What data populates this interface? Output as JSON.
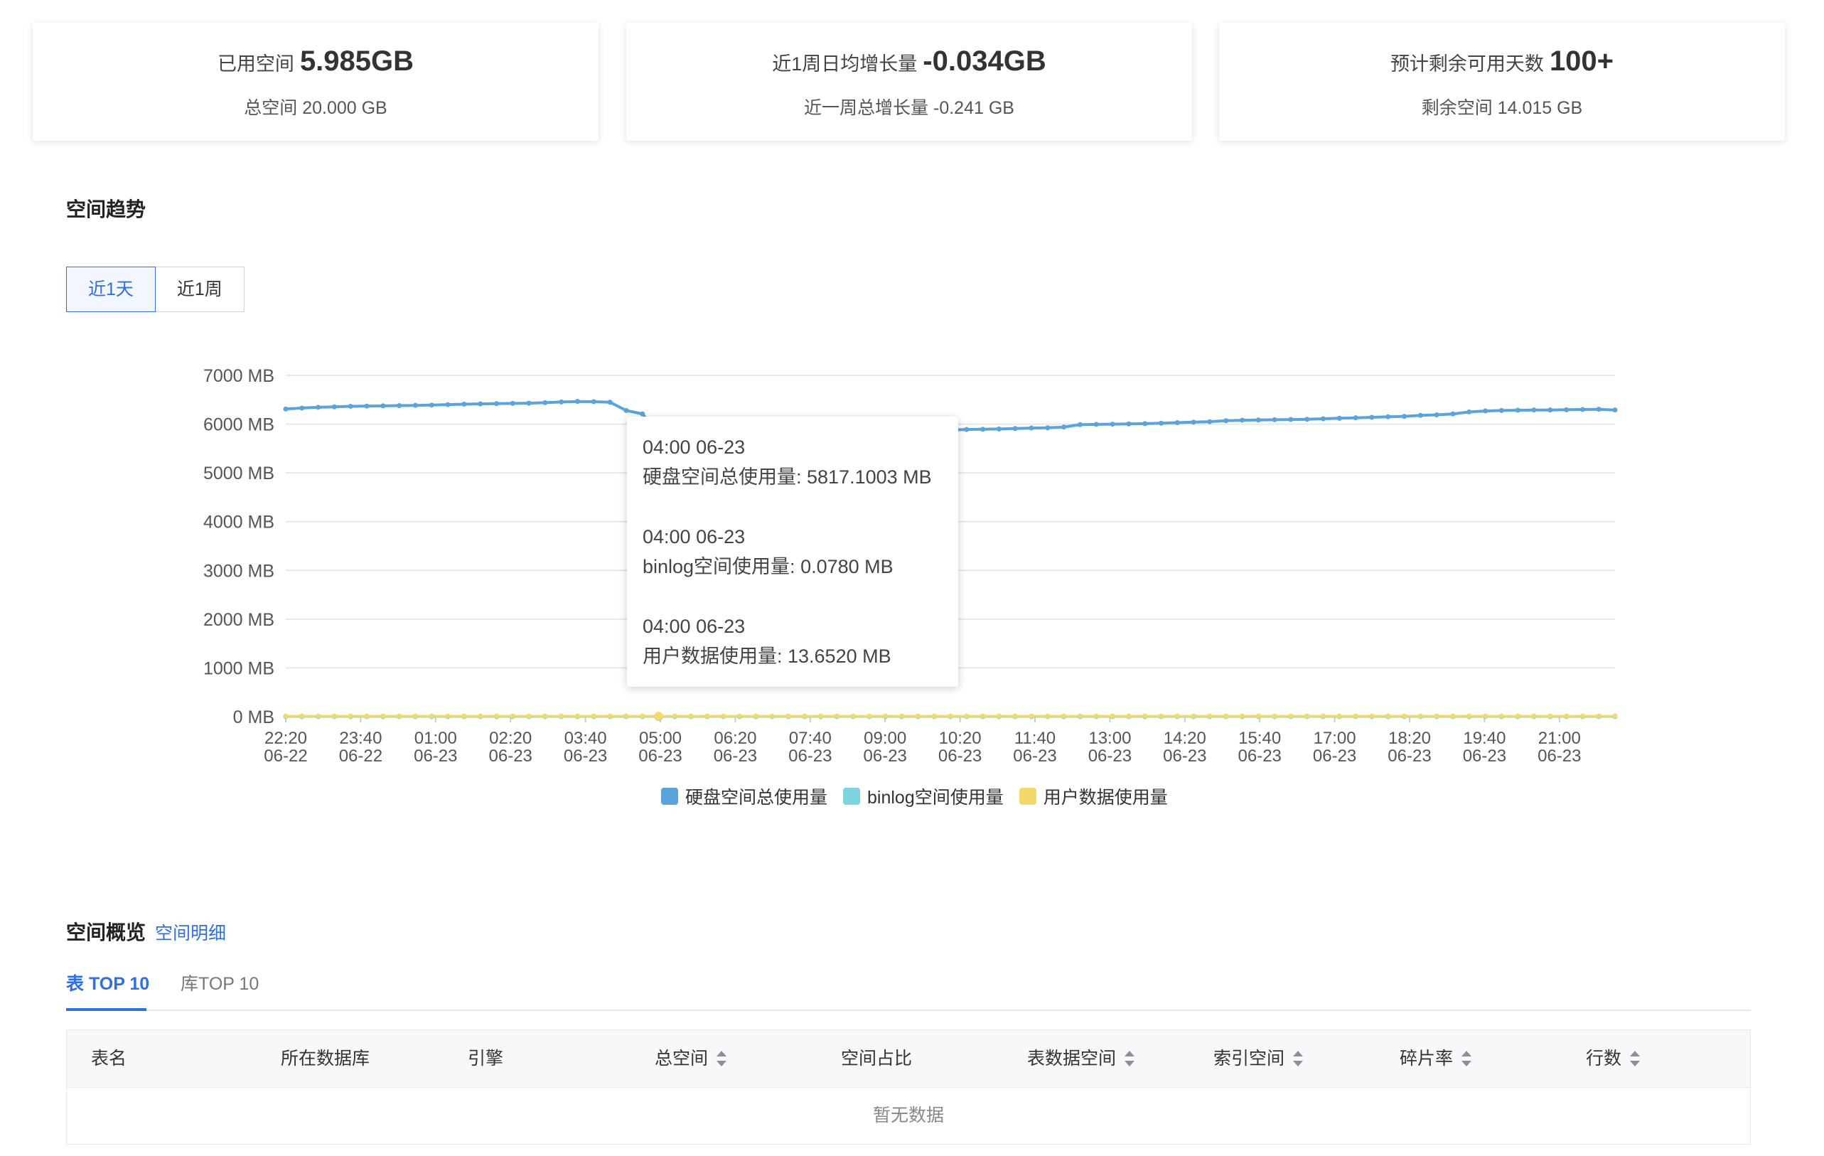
{
  "cards": [
    {
      "label": "已用空间",
      "value": "5.985GB",
      "sub": "总空间 20.000 GB"
    },
    {
      "label": "近1周日均增长量",
      "value": "-0.034GB",
      "sub": "近一周总增长量 -0.241 GB"
    },
    {
      "label": "预计剩余可用天数",
      "value": "100+",
      "sub": "剩余空间 14.015 GB"
    }
  ],
  "trend": {
    "title": "空间趋势",
    "ranges": [
      "近1天",
      "近1周"
    ],
    "active_range": "近1天"
  },
  "tooltip": {
    "groups": [
      {
        "time": "04:00 06-23",
        "text": "硬盘空间总使用量: 5817.1003 MB"
      },
      {
        "time": "04:00 06-23",
        "text": "binlog空间使用量: 0.0780 MB"
      },
      {
        "time": "04:00 06-23",
        "text": "用户数据使用量: 13.6520 MB"
      }
    ]
  },
  "chart_data": {
    "type": "line",
    "y_ticks": [
      "7000 MB",
      "6000 MB",
      "5000 MB",
      "4000 MB",
      "3000 MB",
      "2000 MB",
      "1000 MB",
      "0 MB"
    ],
    "ylim": [
      0,
      7000
    ],
    "x_tick_labels": [
      [
        "22:20",
        "06-22"
      ],
      [
        "23:40",
        "06-22"
      ],
      [
        "01:00",
        "06-23"
      ],
      [
        "02:20",
        "06-23"
      ],
      [
        "03:40",
        "06-23"
      ],
      [
        "05:00",
        "06-23"
      ],
      [
        "06:20",
        "06-23"
      ],
      [
        "07:40",
        "06-23"
      ],
      [
        "09:00",
        "06-23"
      ],
      [
        "10:20",
        "06-23"
      ],
      [
        "11:40",
        "06-23"
      ],
      [
        "13:00",
        "06-23"
      ],
      [
        "14:20",
        "06-23"
      ],
      [
        "15:40",
        "06-23"
      ],
      [
        "17:00",
        "06-23"
      ],
      [
        "18:20",
        "06-23"
      ],
      [
        "19:40",
        "06-23"
      ],
      [
        "21:00",
        "06-23"
      ]
    ],
    "grid": true,
    "legend_position": "bottom",
    "series": [
      {
        "name": "硬盘空间总使用量",
        "color": "#5aa3db",
        "values": [
          6310,
          6330,
          6345,
          6355,
          6365,
          6370,
          6375,
          6380,
          6385,
          6390,
          6400,
          6410,
          6415,
          6420,
          6425,
          6430,
          6440,
          6455,
          6465,
          6460,
          6450,
          6280,
          6210,
          5817,
          5650,
          5620,
          5625,
          5630,
          5640,
          5660,
          5680,
          5700,
          5720,
          5740,
          5760,
          5780,
          5800,
          5820,
          5840,
          5860,
          5870,
          5880,
          5890,
          5895,
          5900,
          5910,
          5920,
          5925,
          5940,
          5990,
          5995,
          6000,
          6005,
          6010,
          6020,
          6030,
          6040,
          6050,
          6070,
          6080,
          6085,
          6090,
          6095,
          6100,
          6110,
          6120,
          6130,
          6140,
          6150,
          6160,
          6180,
          6190,
          6210,
          6250,
          6270,
          6280,
          6285,
          6290,
          6290,
          6295,
          6300,
          6305,
          6290
        ]
      },
      {
        "name": "binlog空间使用量",
        "color": "#7dd3df",
        "values_constant": 0.078
      },
      {
        "name": "用户数据使用量",
        "color": "#f5d86a",
        "values_constant": 13.652
      }
    ]
  },
  "overview": {
    "title": "空间概览",
    "detail_link": "空间明细",
    "tabs": [
      "表 TOP 10",
      "库TOP 10"
    ],
    "active_tab": 0,
    "columns": [
      {
        "label": "表名",
        "sortable": false
      },
      {
        "label": "所在数据库",
        "sortable": false
      },
      {
        "label": "引擎",
        "sortable": false
      },
      {
        "label": "总空间",
        "sortable": true
      },
      {
        "label": "空间占比",
        "sortable": false
      },
      {
        "label": "表数据空间",
        "sortable": true
      },
      {
        "label": "索引空间",
        "sortable": true
      },
      {
        "label": "碎片率",
        "sortable": true
      },
      {
        "label": "行数",
        "sortable": true
      }
    ],
    "empty_text": "暂无数据"
  }
}
